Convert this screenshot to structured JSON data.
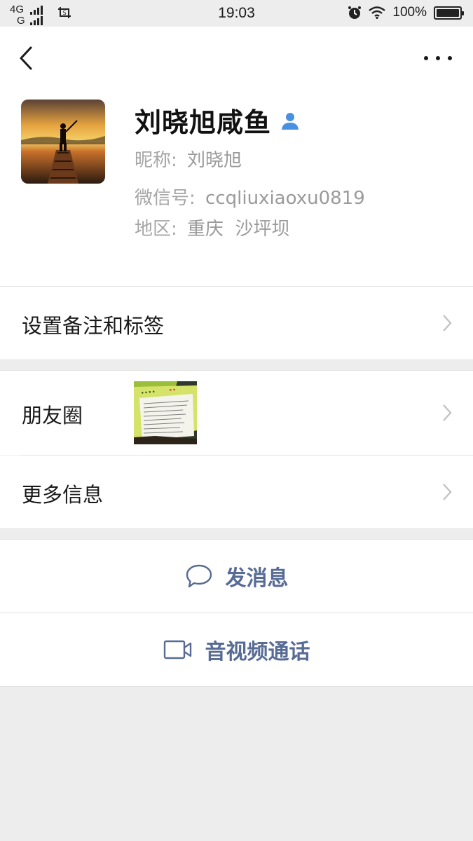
{
  "status_bar": {
    "network_top": "4G",
    "network_bottom": "G",
    "time": "19:03",
    "battery_text": "100%",
    "icons": [
      "signal-icon",
      "screenshot-icon",
      "alarm-icon",
      "wifi-icon",
      "battery-icon"
    ]
  },
  "profile": {
    "display_name": "刘晓旭咸鱼",
    "nickname_label": "昵称:",
    "nickname": "刘晓旭",
    "wechat_id_label": "微信号:",
    "wechat_id": "ccqliuxiaoxu0819",
    "region_label": "地区:",
    "region": "重庆  沙坪坝"
  },
  "menu": {
    "set_remark": "设置备注和标签",
    "moments": "朋友圈",
    "more_info": "更多信息"
  },
  "actions": {
    "send_message": "发消息",
    "video_call": "音视频通话"
  },
  "colors": {
    "accent": "#576b95",
    "badge_blue": "#4a90e2",
    "background": "#ededed"
  }
}
